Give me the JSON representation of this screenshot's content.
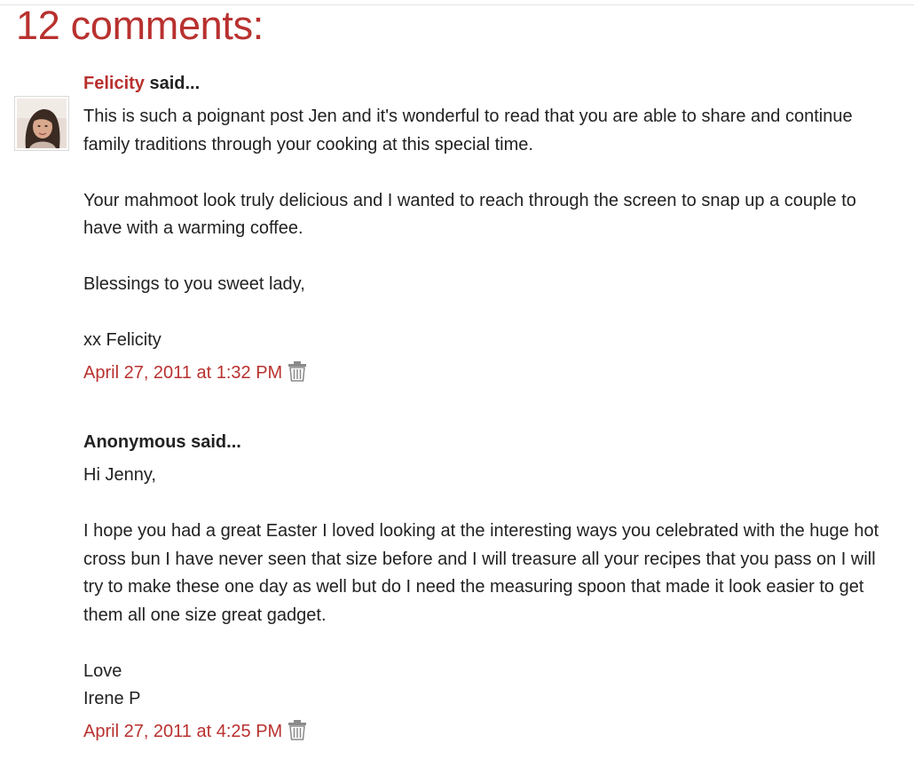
{
  "heading": "12 comments:",
  "said_suffix": " said...",
  "comments": [
    {
      "author": "Felicity",
      "author_is_link": true,
      "paragraphs": [
        "This is such a poignant post Jen and it's wonderful to read that you are able to share and continue family traditions through your cooking at this special time.",
        "Your mahmoot look truly delicious and I wanted to reach through the screen to snap up a couple to have with a warming coffee.",
        "Blessings to you sweet lady,",
        "xx Felicity"
      ],
      "timestamp": "April 27, 2011 at 1:32 PM",
      "has_avatar": true
    },
    {
      "author": "Anonymous",
      "author_is_link": false,
      "paragraphs": [
        "Hi Jenny,",
        "I hope you had a great Easter I loved looking at the interesting ways you celebrated with the huge hot cross bun I have never seen that size before and I will treasure all your recipes that you pass on I will try to make these one day as well but do I need the measuring spoon that made it look easier to get them all one size great gadget.",
        "Love\nIrene P"
      ],
      "timestamp": "April 27, 2011 at 4:25 PM",
      "has_avatar": false
    }
  ],
  "icons": {
    "delete": "trash-icon",
    "avatar": "avatar-photo"
  },
  "colors": {
    "accent": "#b8312f",
    "text": "#222222",
    "icon_gray": "#8a8a8a"
  }
}
